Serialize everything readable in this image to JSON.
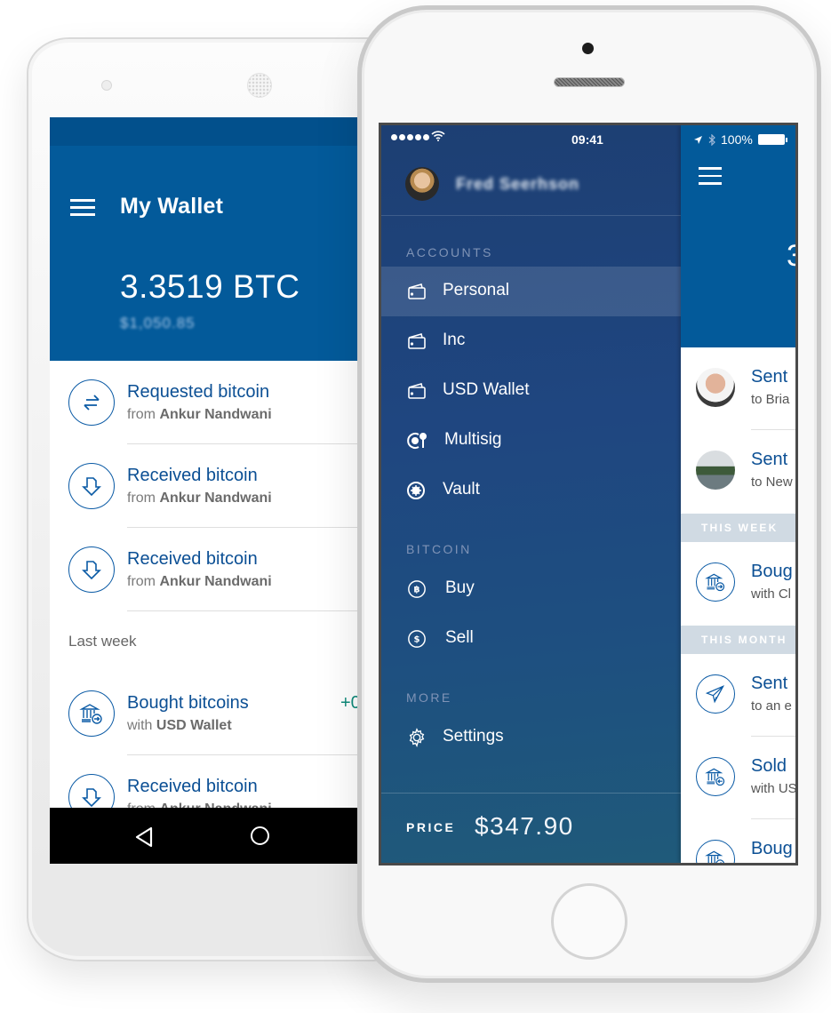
{
  "android": {
    "title": "My Wallet",
    "balance": "3.3519 BTC",
    "fiat_balance_blurred": "$1,050.85",
    "transactions": [
      {
        "title": "Requested bitcoin",
        "prefix": "from",
        "party": "Ankur Nandwani",
        "icon": "swap-arrows-icon"
      },
      {
        "title": "Received bitcoin",
        "prefix": "from",
        "party": "Ankur Nandwani",
        "icon": "receive-down-arrow-icon"
      },
      {
        "title": "Received bitcoin",
        "prefix": "from",
        "party": "Ankur Nandwani",
        "icon": "receive-down-arrow-icon"
      }
    ],
    "section_last_week": "Last week",
    "last_week": [
      {
        "title": "Bought bitcoins",
        "prefix": "with",
        "party": "USD Wallet",
        "amount": "+0",
        "icon": "bank-buy-icon"
      },
      {
        "title": "Received bitcoin",
        "prefix": "from",
        "party": "Ankur Nandwani",
        "icon": "receive-down-arrow-icon"
      }
    ],
    "navbar": {
      "back": "back-triangle-icon",
      "home": "home-circle-icon"
    }
  },
  "iphone": {
    "statusbar": {
      "time": "09:41",
      "battery": "100%"
    },
    "profile": {
      "name_blurred": "Fred Seerhson"
    },
    "drawer": {
      "accounts_heading": "ACCOUNTS",
      "accounts": [
        {
          "label": "Personal",
          "icon": "wallet-icon",
          "active": true
        },
        {
          "label": "Inc",
          "icon": "wallet-icon"
        },
        {
          "label": "USD Wallet",
          "icon": "wallet-icon"
        },
        {
          "label": "Multisig",
          "icon": "vault-key-icon"
        },
        {
          "label": "Vault",
          "icon": "vault-icon"
        }
      ],
      "bitcoin_heading": "BITCOIN",
      "bitcoin": [
        {
          "label": "Buy",
          "icon": "bitcoin-circle-icon"
        },
        {
          "label": "Sell",
          "icon": "dollar-circle-icon"
        }
      ],
      "more_heading": "MORE",
      "more": [
        {
          "label": "Settings",
          "icon": "gear-icon"
        }
      ],
      "price_label": "PRICE",
      "price_value": "$347.90"
    },
    "main": {
      "balance_partial": "3",
      "items_top": [
        {
          "title": "Sent",
          "sub": "to Bria"
        },
        {
          "title": "Sent",
          "sub": "to New"
        }
      ],
      "section_week": "THIS WEEK",
      "items_week": [
        {
          "title": "Boug",
          "sub": "with Cl"
        }
      ],
      "section_month": "THIS MONTH",
      "items_month": [
        {
          "title": "Sent",
          "sub": "to an e"
        },
        {
          "title": "Sold",
          "sub": "with US"
        },
        {
          "title": "Boug",
          "sub": ""
        }
      ]
    }
  }
}
